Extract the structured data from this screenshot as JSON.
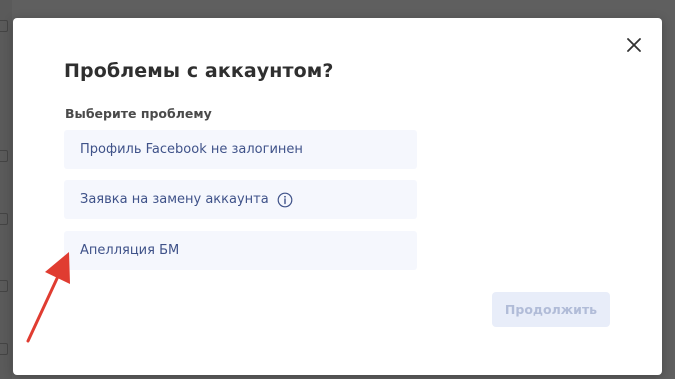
{
  "modal": {
    "title": "Проблемы с аккаунтом?",
    "subtitle": "Выберите проблему",
    "options": [
      {
        "label": "Профиль Facebook не залогинен"
      },
      {
        "label": "Заявка на замену аккаунта",
        "icon": "info-icon"
      },
      {
        "label": "Апелляция БМ"
      }
    ],
    "continue_label": "Продолжить",
    "close_icon": "close-icon"
  },
  "annotation": {
    "arrow_icon": "arrow-icon",
    "arrow_color": "#e03c31"
  },
  "colors": {
    "overlay": "#5f5f5f",
    "option_bg": "#f5f7fd",
    "option_text": "#3f5289",
    "button_disabled_bg": "#e8edf9",
    "button_disabled_text": "#b1bcd8"
  }
}
